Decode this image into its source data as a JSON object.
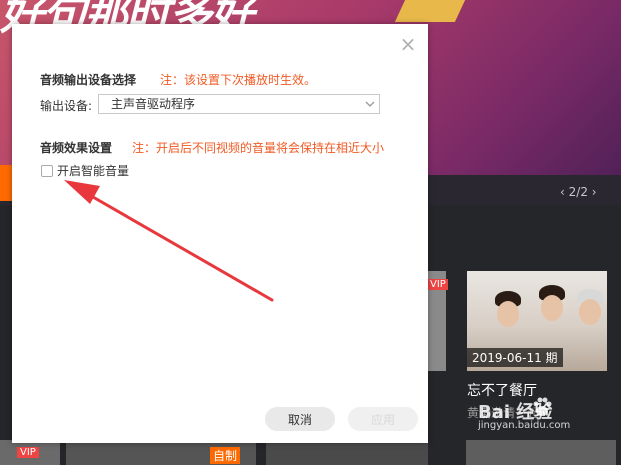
{
  "background": {
    "banner_title": "好句那时多好",
    "pager": "2/2",
    "vip_badge": "VIP",
    "zizhi_badge": "自制",
    "card": {
      "date": "2019-06-11 期",
      "title": "忘不了餐厅",
      "subtitle": "黄渤邀请一起"
    },
    "watermark": "Bai 经验",
    "watermark_sub": "jingyan.baidu.com"
  },
  "dialog": {
    "close_glyph": "×",
    "output_section": {
      "title": "音频输出设备选择",
      "note": "注：该设置下次播放时生效。",
      "device_label": "输出设备:",
      "device_value": "主声音驱动程序"
    },
    "effect_section": {
      "title": "音频效果设置",
      "note": "注：开启后不同视频的音量将会保持在相近大小",
      "checkbox_label": "开启智能音量",
      "checkbox_checked": false
    },
    "buttons": {
      "cancel": "取消",
      "apply": "应用"
    }
  },
  "colors": {
    "accent": "#f15a24",
    "annotation_arrow": "#e8383d"
  }
}
